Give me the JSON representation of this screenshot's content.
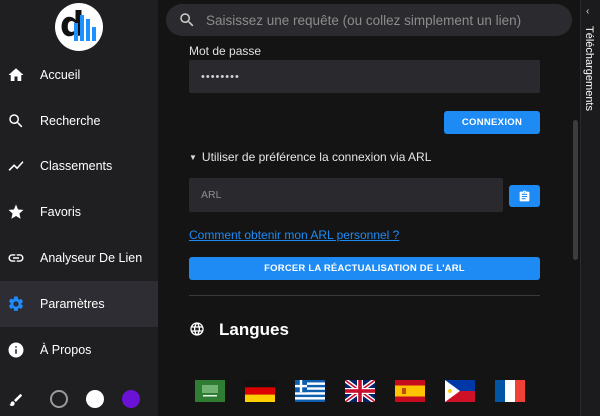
{
  "sidebar": {
    "logo": {
      "letter": "d"
    },
    "items": [
      {
        "label": "Accueil",
        "icon": "home-icon",
        "active": false
      },
      {
        "label": "Recherche",
        "icon": "search-icon",
        "active": false
      },
      {
        "label": "Classements",
        "icon": "trending-icon",
        "active": false
      },
      {
        "label": "Favoris",
        "icon": "star-icon",
        "active": false
      },
      {
        "label": "Analyseur De Lien",
        "icon": "link-icon",
        "active": false
      },
      {
        "label": "Paramètres",
        "icon": "gear-icon",
        "active": true
      },
      {
        "label": "À Propos",
        "icon": "info-icon",
        "active": false
      }
    ],
    "themes": [
      {
        "name": "dark-theme",
        "color": "#1f1f22"
      },
      {
        "name": "light-theme",
        "color": "#ffffff"
      },
      {
        "name": "purple-theme",
        "color": "#6a12d6"
      }
    ]
  },
  "search": {
    "placeholder": "Saisissez une requête (ou collez simplement un lien)"
  },
  "login": {
    "password_label": "Mot de passe",
    "password_value": "••••••••",
    "login_button": "CONNEXION",
    "arl_toggle": "Utiliser de préférence la connexion via ARL",
    "arl_placeholder": "ARL",
    "arl_link": "Comment obtenir mon ARL personnel ?",
    "refresh_button": "FORCER LA RÉACTUALISATION DE L'ARL"
  },
  "languages": {
    "title": "Langues",
    "flags": [
      "arabic-flag-icon",
      "german-flag-icon",
      "greek-flag-icon",
      "uk-flag-icon",
      "spanish-flag-icon",
      "philippines-flag-icon",
      "french-flag-icon"
    ]
  },
  "right_rail": {
    "label": "Téléchargements"
  },
  "colors": {
    "accent": "#1e8bf5",
    "sidebar_bg": "#1f1f22",
    "page_bg": "#141414"
  }
}
